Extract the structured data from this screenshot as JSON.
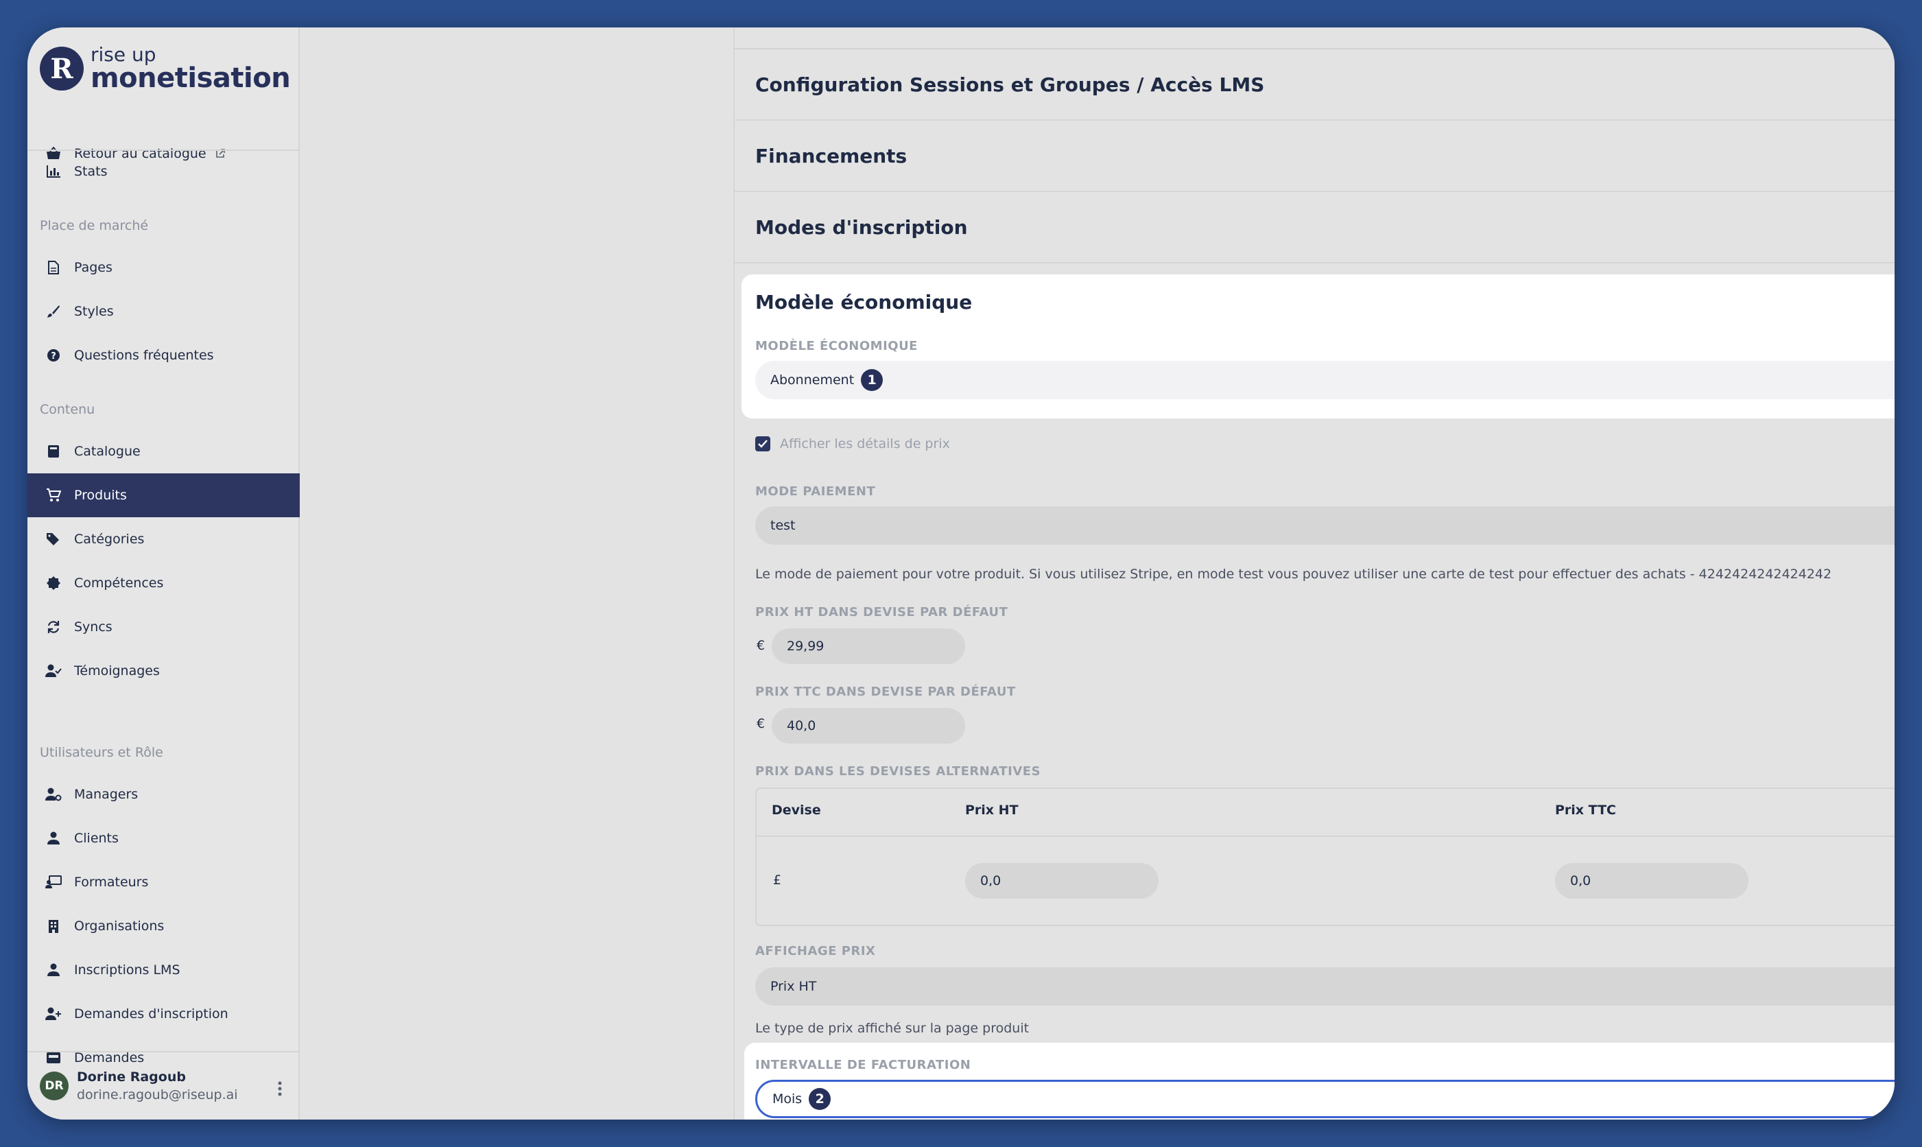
{
  "brand": {
    "line1": "rise up",
    "line2": "monetisation",
    "mark": "R"
  },
  "sidebar": {
    "back_link": "Retour au catalogue",
    "stats": "Stats",
    "sections": {
      "marketplace": "Place de marché",
      "content": "Contenu",
      "users": "Utilisateurs et Rôle"
    },
    "marketplace_items": [
      "Pages",
      "Styles",
      "Questions fréquentes"
    ],
    "content_items": [
      "Catalogue",
      "Produits",
      "Catégories",
      "Compétences",
      "Syncs",
      "Témoignages"
    ],
    "user_items": [
      "Managers",
      "Clients",
      "Formateurs",
      "Organisations",
      "Inscriptions LMS",
      "Demandes d'inscription",
      "Demandes"
    ],
    "active_item": "Produits"
  },
  "user": {
    "initials": "DR",
    "name": "Dorine Ragoub",
    "email": "dorine.ragoub@riseup.ai"
  },
  "accordions": {
    "sessions": "Configuration Sessions et Groupes / Accès LMS",
    "financements": "Financements",
    "modes": "Modes d'inscription",
    "modele": "Modèle économique"
  },
  "form": {
    "modele_label": "MODÈLE ÉCONOMIQUE",
    "modele_value": "Abonnement",
    "modele_badge": "1",
    "show_price_label": "Afficher les détails de prix",
    "mode_paiement_label": "MODE PAIEMENT",
    "mode_paiement_value": "test",
    "mode_paiement_help": "Le mode de paiement pour votre produit. Si vous utilisez Stripe, en mode test vous pouvez utiliser une carte de test pour effectuer des achats - 4242424242424242",
    "prix_ht_label": "PRIX HT DANS DEVISE PAR DÉFAUT",
    "prix_ht_currency": "€",
    "prix_ht_value": "29,99",
    "prix_ttc_label": "PRIX TTC DANS DEVISE PAR DÉFAUT",
    "prix_ttc_currency": "€",
    "prix_ttc_value": "40,0",
    "alt_label": "PRIX DANS LES DEVISES ALTERNATIVES",
    "alt_table": {
      "headers": [
        "Devise",
        "Prix HT",
        "Prix TTC"
      ],
      "rows": [
        {
          "devise": "£",
          "ht": "0,0",
          "ttc": "0,0"
        }
      ]
    },
    "affichage_label": "AFFICHAGE PRIX",
    "affichage_value": "Prix HT",
    "affichage_help": "Le type de prix affiché sur la page produit",
    "intervalle_label": "INTERVALLE DE FACTURATION",
    "intervalle_value": "Mois",
    "intervalle_badge": "2"
  }
}
